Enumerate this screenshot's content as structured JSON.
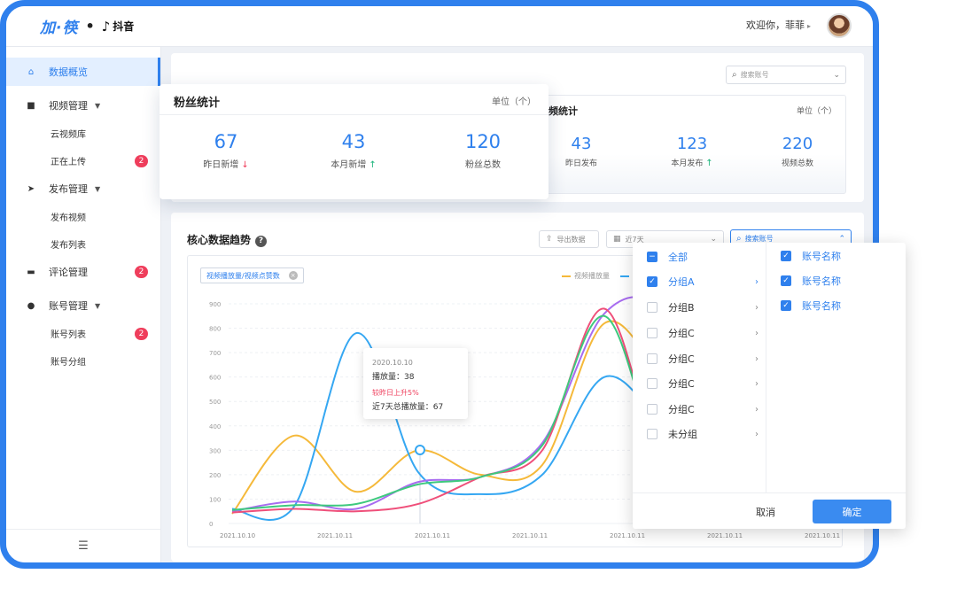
{
  "header": {
    "logo_main": "加·筷",
    "logo_partner": "抖音",
    "welcome": "欢迎你，菲菲"
  },
  "sidebar": {
    "items": [
      {
        "label": "数据概览",
        "icon": "home-icon"
      },
      {
        "label": "视频管理",
        "icon": "video-icon"
      },
      {
        "label": "云视频库"
      },
      {
        "label": "正在上传",
        "badge": "2"
      },
      {
        "label": "发布管理",
        "icon": "send-icon"
      },
      {
        "label": "发布视频"
      },
      {
        "label": "发布列表"
      },
      {
        "label": "评论管理",
        "icon": "comment-icon",
        "badge": "2"
      },
      {
        "label": "账号管理",
        "icon": "user-icon"
      },
      {
        "label": "账号列表",
        "badge": "2"
      },
      {
        "label": "账号分组"
      }
    ]
  },
  "top_search": {
    "placeholder": "搜索账号"
  },
  "fans": {
    "title": "粉丝统计",
    "unit": "单位（个）",
    "stats": [
      {
        "value": "67",
        "label": "昨日新增",
        "trend": "down"
      },
      {
        "value": "43",
        "label": "本月新增",
        "trend": "up"
      },
      {
        "value": "120",
        "label": "粉丝总数"
      }
    ]
  },
  "videos": {
    "title": "视频统计",
    "unit": "单位（个）",
    "stats": [
      {
        "value": "43",
        "label": "昨日发布"
      },
      {
        "value": "123",
        "label": "本月发布",
        "trend": "up"
      },
      {
        "value": "220",
        "label": "视频总数"
      }
    ]
  },
  "trend": {
    "title": "核心数据趋势",
    "export": "导出数据",
    "range": "近7天",
    "search": "搜索账号",
    "tag": "视频播放量/视频点赞数",
    "legend": [
      "视频播放量",
      "视"
    ]
  },
  "tooltip": {
    "date": "2020.10.10",
    "plays": "播放量：38",
    "change": "较昨日上升5%",
    "total": "近7天总播放量：67"
  },
  "dropdown": {
    "groups": [
      {
        "label": "全部",
        "state": "partial"
      },
      {
        "label": "分组A",
        "state": "on",
        "selected": true
      },
      {
        "label": "分组B"
      },
      {
        "label": "分组C"
      },
      {
        "label": "分组C"
      },
      {
        "label": "分组C"
      },
      {
        "label": "分组C"
      },
      {
        "label": "未分组"
      }
    ],
    "accounts": [
      "账号名称",
      "账号名称",
      "账号名称"
    ],
    "cancel": "取消",
    "confirm": "确定"
  },
  "chart_data": {
    "type": "line",
    "y_ticks": [
      "900",
      "800",
      "700",
      "600",
      "500",
      "400",
      "300",
      "200",
      "100",
      "0"
    ],
    "ylim": [
      0,
      900
    ],
    "x_ticks": [
      "2021.10.10",
      "2021.10.11",
      "2021.10.11",
      "2021.10.11",
      "2021.10.11",
      "2021.10.11",
      "2021.10.11"
    ],
    "series": [
      {
        "color": "#f5b93a",
        "values": [
          40,
          360,
          130,
          300,
          200,
          240,
          820,
          580,
          350
        ]
      },
      {
        "color": "#35a7f2",
        "values": [
          60,
          70,
          780,
          210,
          120,
          200,
          600,
          400,
          250
        ]
      },
      {
        "color": "#a86cf0",
        "values": [
          50,
          90,
          60,
          170,
          190,
          330,
          860,
          860,
          300
        ]
      },
      {
        "color": "#ef4f7a",
        "values": [
          45,
          60,
          50,
          80,
          190,
          300,
          880,
          200,
          220
        ]
      },
      {
        "color": "#3ec97e",
        "values": [
          55,
          75,
          80,
          160,
          190,
          320,
          850,
          200,
          180
        ]
      }
    ]
  }
}
